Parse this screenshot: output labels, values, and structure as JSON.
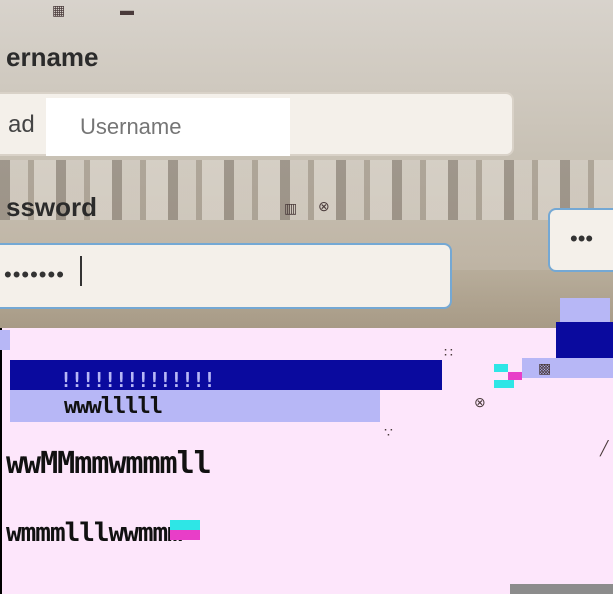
{
  "login": {
    "username_label": "ername",
    "username_prefix": "ad",
    "username_placeholder": "Username",
    "password_label": "ssword",
    "password_value": "•••••••",
    "password_value_2": "•••"
  },
  "glitch": {
    "noise_1": "!!!!!!!!!!!!!!",
    "noise_2": "wwwlllll",
    "noise_3": "wwMMmmwmmmll",
    "noise_4": "wmmmlllwwmmm"
  },
  "colors": {
    "accent_blue": "#0a0a9e",
    "accent_purple": "#b7b7f6",
    "glitch_pink": "#fde6fb",
    "focus_border": "#74a8d4"
  }
}
